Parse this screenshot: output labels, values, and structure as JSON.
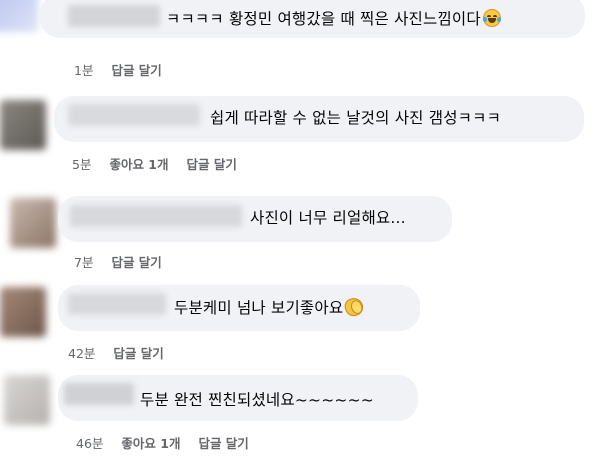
{
  "comments": [
    {
      "text": "ㅋㅋㅋㅋ 황정민 여행갔을 때 찍은 사진느낌이다",
      "emoji": "laughing-tears-emoji",
      "time": "1분",
      "like": "",
      "reply": "답글 달기"
    },
    {
      "text": "쉽게 따라할 수 없는 날것의 사진 갬성ㅋㅋㅋ",
      "emoji": "",
      "time": "5분",
      "like": "좋아요 1개",
      "reply": "답글 달기"
    },
    {
      "text": "사진이 너무 리얼해요...",
      "emoji": "",
      "time": "7분",
      "like": "",
      "reply": "답글 달기"
    },
    {
      "text": "두분케미 넘나 보기좋아요",
      "emoji": "clapping-hands-emoji",
      "time": "42분",
      "like": "",
      "reply": "답글 달기"
    },
    {
      "text": "두분 완전 찐친되셨네요~~~~~~",
      "emoji": "",
      "time": "46분",
      "like": "좋아요 1개",
      "reply": "답글 달기"
    }
  ],
  "colors": {
    "bubble": "#f0f2f5",
    "meta_text": "#65676b",
    "comment_text": "#050505"
  }
}
